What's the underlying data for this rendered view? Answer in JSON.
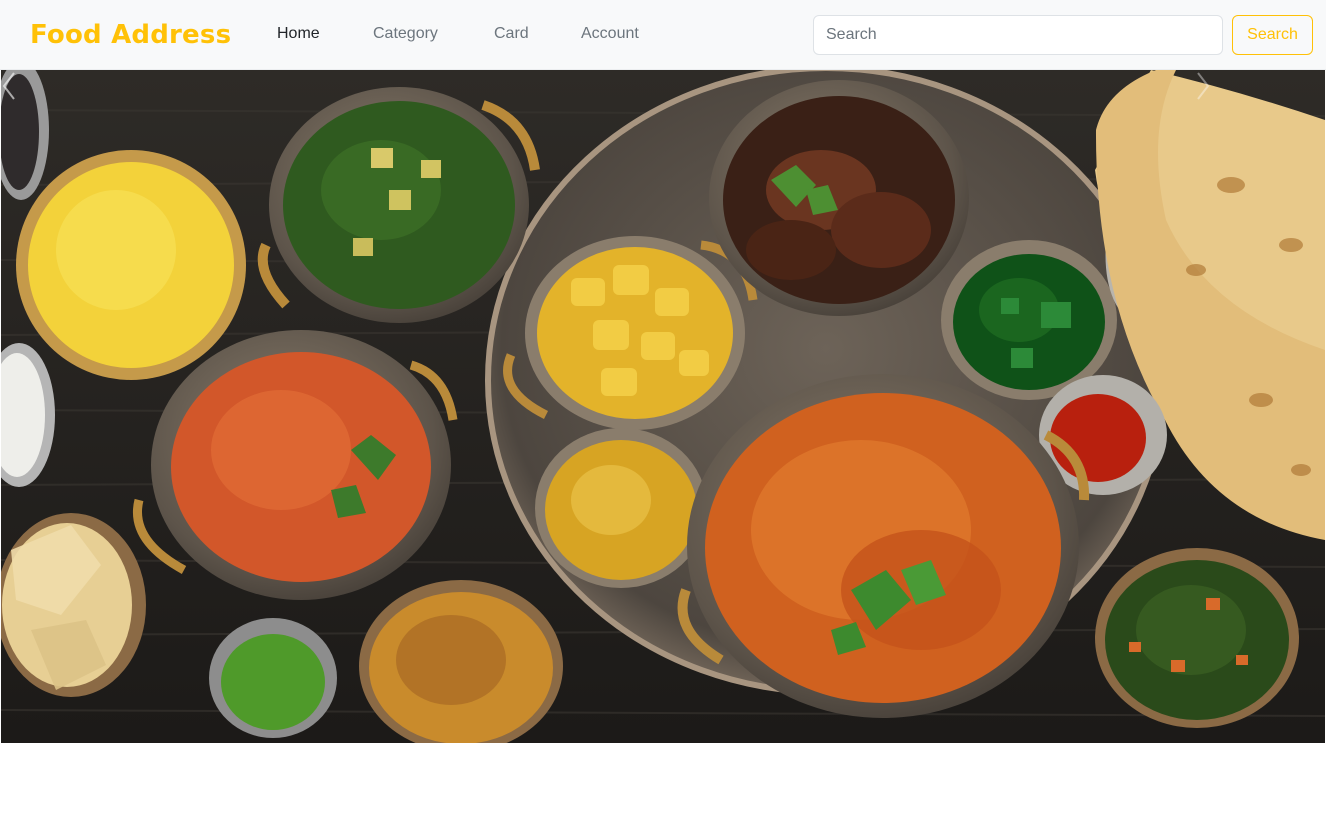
{
  "navbar": {
    "brand": "Food Address",
    "links": [
      {
        "label": "Home",
        "active": true
      },
      {
        "label": "Category",
        "active": false
      },
      {
        "label": "Card",
        "active": false
      },
      {
        "label": "Account",
        "active": false
      }
    ],
    "search": {
      "placeholder": "Search",
      "value": ""
    },
    "search_button": "Search"
  },
  "carousel": {
    "prev_icon": "chevron-left-icon",
    "next_icon": "chevron-right-icon"
  },
  "colors": {
    "brand": "#ffc107",
    "navbar_bg": "#f8f9fa",
    "nav_active": "#212529",
    "nav_inactive": "#6c757d"
  }
}
